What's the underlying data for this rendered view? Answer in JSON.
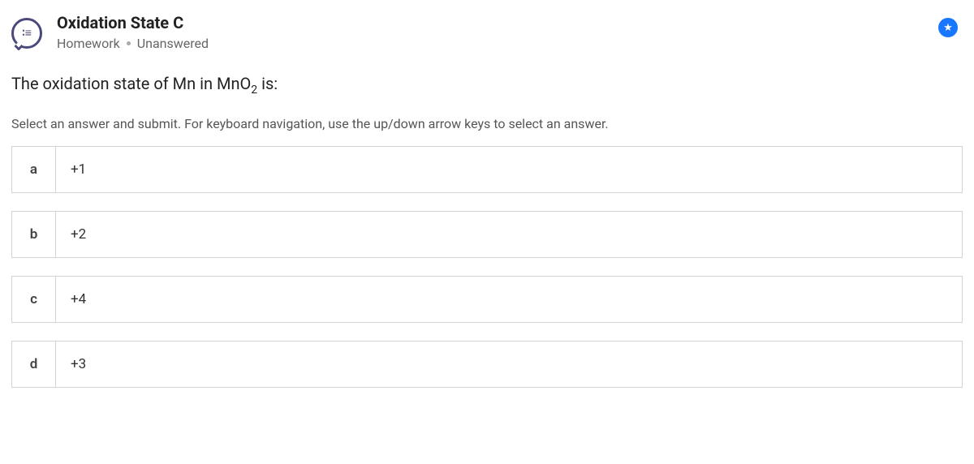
{
  "header": {
    "title": "Oxidation State C",
    "category": "Homework",
    "status": "Unanswered"
  },
  "question": {
    "prefix": "The oxidation state of Mn in ",
    "formula_main": "MnO",
    "formula_sub": "2",
    "suffix": " is:"
  },
  "instruction": "Select an answer and submit. For keyboard navigation, use the up/down arrow keys to select an answer.",
  "options": [
    {
      "letter": "a",
      "text": "+1"
    },
    {
      "letter": "b",
      "text": "+2"
    },
    {
      "letter": "c",
      "text": "+4"
    },
    {
      "letter": "d",
      "text": "+3"
    }
  ]
}
